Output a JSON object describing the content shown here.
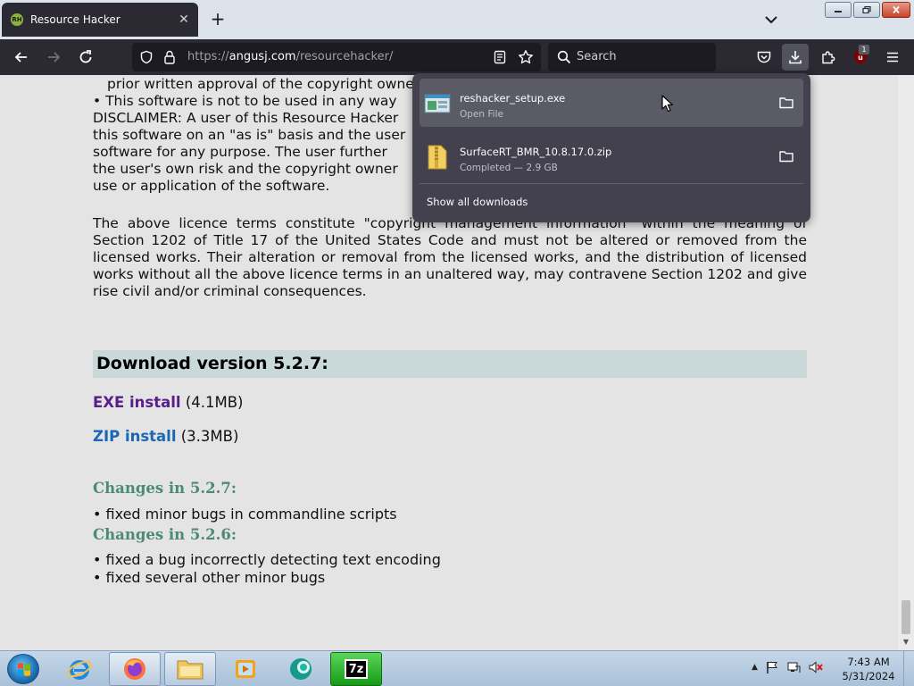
{
  "browser": {
    "tab": {
      "favicon_text": "RH",
      "title": "Resource Hacker"
    },
    "url": {
      "prefix": "https://",
      "host": "angusj.com",
      "path": "/resourcehacker/"
    },
    "search_placeholder": "Search",
    "extension_badge": "1"
  },
  "page": {
    "licence_top": [
      "prior written approval of the copyright owner",
      "• This software is not to be used in any way",
      "DISCLAIMER: A user of this Resource Hacker",
      "this software on an \"as is\" basis and the user",
      "software for any purpose. The user further",
      "the user's own risk and the copyright owner",
      "use or application of the software."
    ],
    "licence_para": "The above licence terms constitute \"copyright management information\" within the meaning of Section 1202 of Title 17 of the United States Code and must not be altered or removed from the licensed works. Their alteration or removal from the licensed works, and the distribution of licensed works without all the above licence terms in an unaltered way, may contravene Section 1202 and give rise civil and/or criminal consequences.",
    "download_heading": "Download version 5.2.7:",
    "exe_link": "EXE install",
    "exe_size": "(4.1MB)",
    "zip_link": "ZIP install",
    "zip_size": "(3.3MB)",
    "changes": [
      {
        "heading": "Changes in 5.2.7:",
        "items": [
          "• fixed minor bugs in commandline scripts"
        ]
      },
      {
        "heading": "Changes in 5.2.6:",
        "items": [
          "• fixed a bug incorrectly detecting text encoding",
          "• fixed several other minor bugs"
        ]
      }
    ]
  },
  "downloads_panel": {
    "items": [
      {
        "name": "reshacker_setup.exe",
        "status": "Open File"
      },
      {
        "name": "SurfaceRT_BMR_10.8.17.0.zip",
        "status": "Completed — 2.9 GB"
      }
    ],
    "show_all": "Show all downloads"
  },
  "taskbar": {
    "time": "7:43 AM",
    "date": "5/31/2024",
    "sevenzip_label": "7z"
  }
}
